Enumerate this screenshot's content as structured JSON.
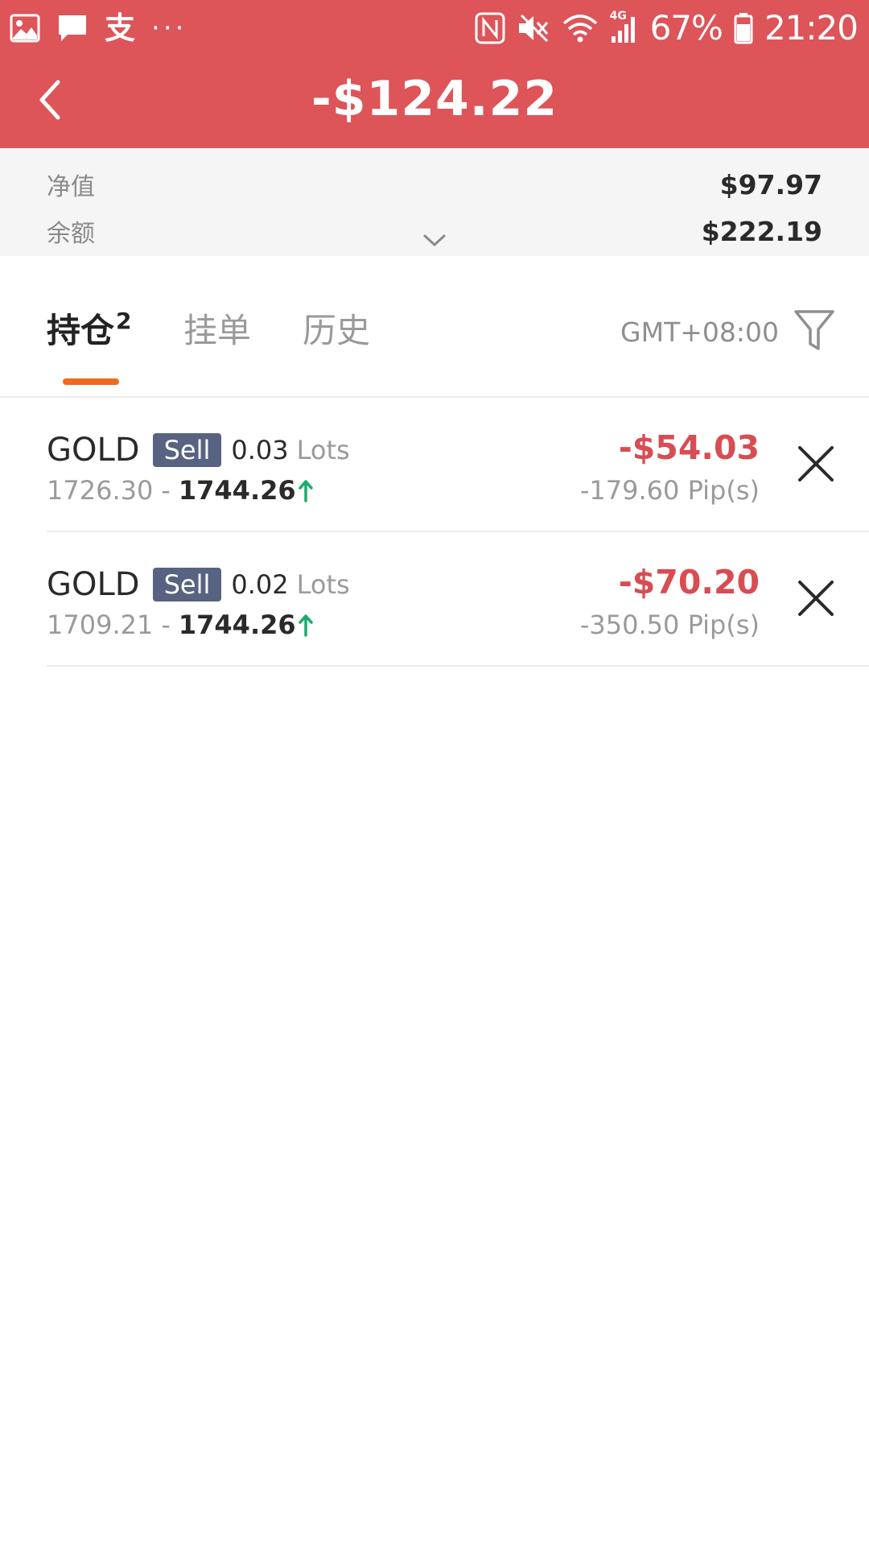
{
  "status_bar": {
    "ime_glyph": "支",
    "more": "···",
    "battery": "67%",
    "time": "21:20",
    "network": "4G",
    "icons": [
      "image-icon",
      "message-icon",
      "ime-icon",
      "more-icon",
      "nfc-icon",
      "mute-icon",
      "wifi-icon",
      "signal-icon",
      "battery-icon"
    ]
  },
  "header": {
    "title": "-$124.22",
    "back_icon": "chevron-left-icon",
    "background_color": "#dd5459"
  },
  "summary": {
    "equity_label": "净值",
    "equity_value": "$97.97",
    "balance_label": "余额",
    "balance_value": "$222.19",
    "expand_icon": "chevron-down-icon"
  },
  "tabs": {
    "items": [
      {
        "label": "持仓",
        "badge": "2",
        "active": true
      },
      {
        "label": "挂单",
        "active": false
      },
      {
        "label": "历史",
        "active": false
      }
    ],
    "timezone": "GMT+08:00",
    "filter_icon": "filter-icon",
    "accent_color": "#ef6a1a"
  },
  "positions": [
    {
      "symbol": "GOLD",
      "side": "Sell",
      "lots": "0.03",
      "lots_unit": "Lots",
      "open_price": "1726.30",
      "separator": "-",
      "current_price": "1744.26",
      "trend_icon": "arrow-up-icon",
      "pnl": "-$54.03",
      "pips": "-179.60 Pip(s)"
    },
    {
      "symbol": "GOLD",
      "side": "Sell",
      "lots": "0.02",
      "lots_unit": "Lots",
      "open_price": "1709.21",
      "separator": "-",
      "current_price": "1744.26",
      "trend_icon": "arrow-up-icon",
      "pnl": "-$70.20",
      "pips": "-350.50 Pip(s)"
    }
  ],
  "colors": {
    "loss": "#d84c52",
    "up": "#1aab6b",
    "side_badge": "#576380"
  }
}
